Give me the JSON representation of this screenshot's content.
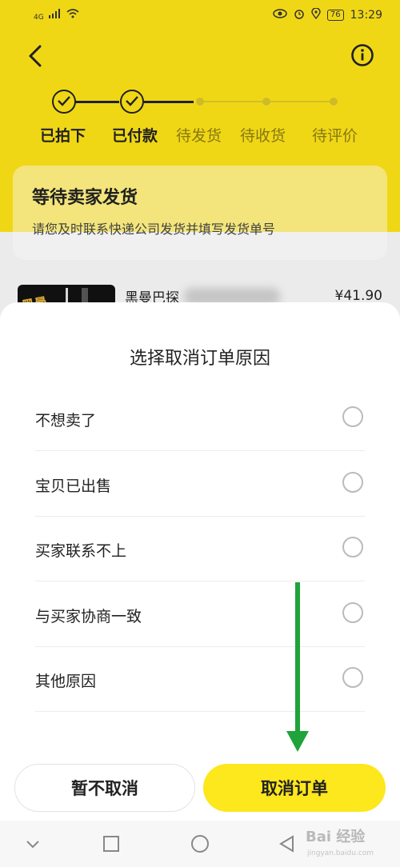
{
  "status_bar": {
    "signal": "4G",
    "battery": "76",
    "time": "13:29"
  },
  "steps": [
    {
      "label": "已拍下",
      "done": true
    },
    {
      "label": "已付款",
      "done": true
    },
    {
      "label": "待发货",
      "done": false
    },
    {
      "label": "待收货",
      "done": false
    },
    {
      "label": "待评价",
      "done": false
    }
  ],
  "status_card": {
    "title": "等待卖家发货",
    "subtitle": "请您及时联系快递公司发货并填写发货单号"
  },
  "product": {
    "name": "黑曼巴探",
    "price": "¥41.90"
  },
  "sheet": {
    "title": "选择取消订单原因",
    "options": [
      "不想卖了",
      "宝贝已出售",
      "买家联系不上",
      "与买家协商一致",
      "其他原因"
    ],
    "keep_label": "暂不取消",
    "cancel_label": "取消订单"
  },
  "watermark": {
    "text": "Bai 经验",
    "sub": "jingyan.baidu.com"
  },
  "colors": {
    "brand_yellow": "#f8de17",
    "button_yellow": "#fde71d",
    "arrow_green": "#1fa33a"
  }
}
